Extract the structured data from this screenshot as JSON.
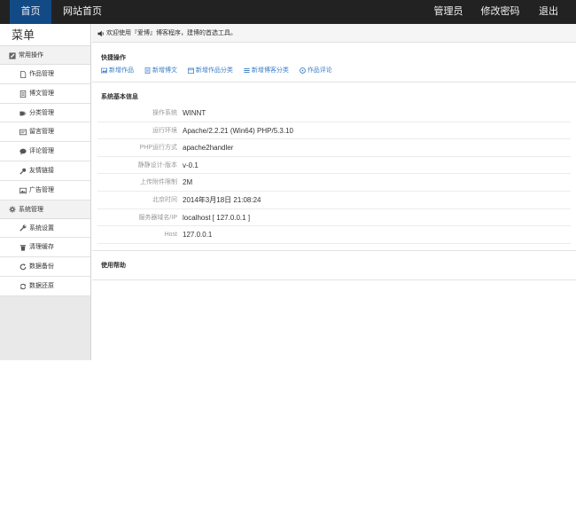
{
  "topnav": {
    "home": "首页",
    "site_home": "网站首页",
    "admin": "管理员",
    "change_password": "修改密码",
    "logout": "退出"
  },
  "sidebar": {
    "title": "菜单",
    "groups": [
      {
        "label": "常用操作",
        "icon": "edit-icon",
        "items": [
          {
            "label": "作品管理",
            "icon": "file-icon"
          },
          {
            "label": "博文管理",
            "icon": "document-icon"
          },
          {
            "label": "分类管理",
            "icon": "tags-icon"
          },
          {
            "label": "留言管理",
            "icon": "message-icon"
          },
          {
            "label": "评论管理",
            "icon": "comment-icon"
          },
          {
            "label": "友情链接",
            "icon": "link-icon"
          },
          {
            "label": "广告管理",
            "icon": "picture-icon"
          }
        ]
      },
      {
        "label": "系统管理",
        "icon": "gear-icon",
        "items": [
          {
            "label": "系统设置",
            "icon": "wrench-icon"
          },
          {
            "label": "清理缓存",
            "icon": "trash-icon"
          },
          {
            "label": "数据备份",
            "icon": "backup-icon"
          },
          {
            "label": "数据还原",
            "icon": "restore-icon"
          }
        ]
      }
    ]
  },
  "notice": "欢迎使用『爱博』博客程序，建博的首选工具。",
  "quick": {
    "title": "快捷操作",
    "links": [
      {
        "label": "新增作品",
        "icon": "image-icon"
      },
      {
        "label": "新增博文",
        "icon": "document-icon"
      },
      {
        "label": "新增作品分类",
        "icon": "calendar-icon"
      },
      {
        "label": "新增博客分类",
        "icon": "list-icon"
      },
      {
        "label": "作品评论",
        "icon": "circle-icon"
      }
    ]
  },
  "sysinfo": {
    "title": "系统基本信息",
    "rows": [
      {
        "label": "操作系统",
        "value": "WINNT"
      },
      {
        "label": "运行环境",
        "value": "Apache/2.2.21 (Win64) PHP/5.3.10"
      },
      {
        "label": "PHP运行方式",
        "value": "apache2handler"
      },
      {
        "label": "静静设计-版本",
        "value": "v-0.1"
      },
      {
        "label": "上传附件限制",
        "value": "2M"
      },
      {
        "label": "北京时间",
        "value": "2014年3月18日 21:08:24"
      },
      {
        "label": "服务器域名/IP",
        "value": "localhost [ 127.0.0.1 ]"
      },
      {
        "label": "Host",
        "value": "127.0.0.1"
      }
    ]
  },
  "help": {
    "title": "使用帮助"
  },
  "colors": {
    "topbar": "#222222",
    "active_nav": "#124a86",
    "link": "#3a7cc4",
    "sidebar_bg": "#e9e9e9"
  }
}
